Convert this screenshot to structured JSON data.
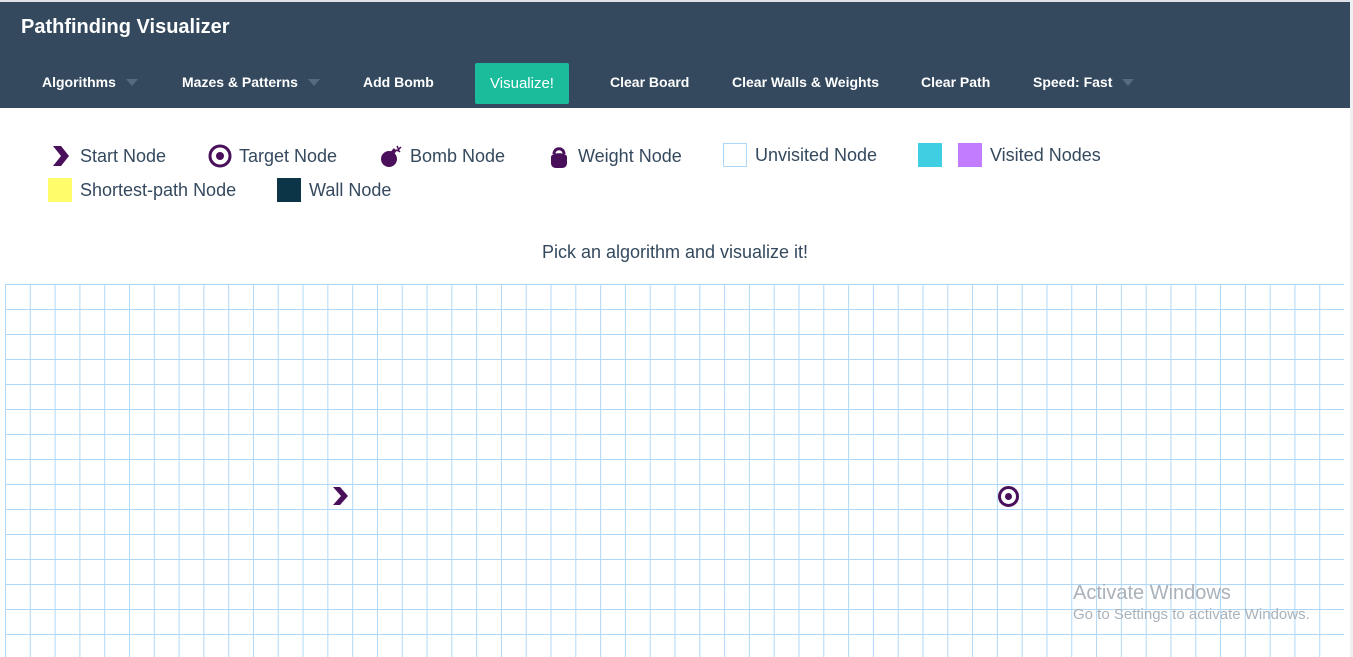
{
  "app": {
    "title": "Pathfinding Visualizer"
  },
  "navbar": {
    "algorithms_label": "Algorithms",
    "mazes_label": "Mazes & Patterns",
    "add_bomb_label": "Add Bomb",
    "visualize_label": "Visualize!",
    "clear_board_label": "Clear Board",
    "clear_walls_weights_label": "Clear Walls & Weights",
    "clear_path_label": "Clear Path",
    "speed_label": "Speed: Fast"
  },
  "legend": {
    "start": "Start Node",
    "target": "Target Node",
    "bomb": "Bomb Node",
    "weight": "Weight Node",
    "unvisited": "Unvisited Node",
    "visited": "Visited Nodes",
    "shortest_path": "Shortest-path Node",
    "wall": "Wall Node"
  },
  "instruction": "Pick an algorithm and visualize it!",
  "colors": {
    "navbar": "#34495e",
    "accent": "#1abc9c",
    "node_icon": "#4a0f5a",
    "visited_primary": "#40cee3",
    "visited_secondary": "#c27cff",
    "shortest_path": "#fffe6a",
    "wall": "#0c3547",
    "grid_line": "#afd8f8"
  },
  "icons": {
    "start": "chevron-right-icon",
    "target": "target-circle-icon",
    "bomb": "bomb-icon",
    "weight": "kettlebell-icon"
  },
  "watermark": {
    "title": "Activate Windows",
    "subtitle": "Go to Settings to activate Windows."
  }
}
